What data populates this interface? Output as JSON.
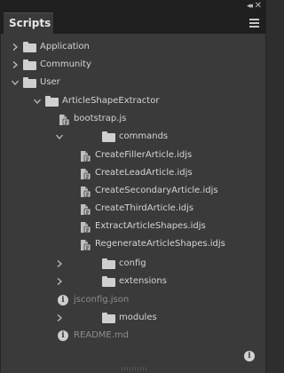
{
  "panel": {
    "title": "Scripts",
    "tab_close": "✕",
    "collapse_glyph": "◂◂",
    "close_glyph": "✕",
    "menu_icon": "hamburger-menu-icon"
  },
  "tree": [
    {
      "label": "Application",
      "type": "folder",
      "expanded": false
    },
    {
      "label": "Community",
      "type": "folder",
      "expanded": false
    },
    {
      "label": "User",
      "type": "folder",
      "expanded": true
    },
    {
      "label": "ArticleShapeExtractor",
      "type": "folder",
      "expanded": true
    },
    {
      "label": "bootstrap.js",
      "type": "script"
    },
    {
      "label": "commands",
      "type": "folder",
      "expanded": true
    },
    {
      "label": "CreateFillerArticle.idjs",
      "type": "script"
    },
    {
      "label": "CreateLeadArticle.idjs",
      "type": "script"
    },
    {
      "label": "CreateSecondaryArticle.idjs",
      "type": "script"
    },
    {
      "label": "CreateThirdArticle.idjs",
      "type": "script"
    },
    {
      "label": "ExtractArticleShapes.idjs",
      "type": "script"
    },
    {
      "label": "RegenerateArticleShapes.idjs",
      "type": "script"
    },
    {
      "label": "config",
      "type": "folder",
      "expanded": false
    },
    {
      "label": "extensions",
      "type": "folder",
      "expanded": false
    },
    {
      "label": "jsconfig.json",
      "type": "info"
    },
    {
      "label": "modules",
      "type": "folder",
      "expanded": false
    },
    {
      "label": "README.md",
      "type": "info"
    }
  ],
  "footer": {
    "info_glyph": "i"
  },
  "colors": {
    "panel_bg": "#3a3a3a",
    "header_bg": "#1f1f1f",
    "text": "#d4d4d4",
    "dim_text": "#8d8d8d"
  }
}
